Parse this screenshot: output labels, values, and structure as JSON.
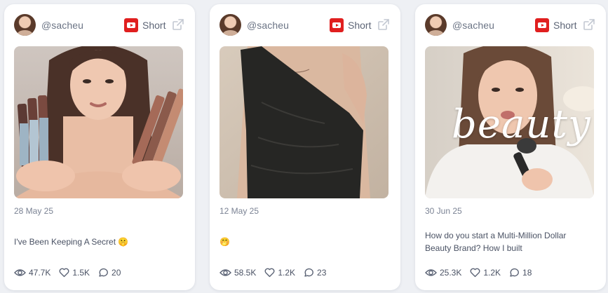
{
  "posts": [
    {
      "handle": "@sacheu",
      "type_label": "Short",
      "date": "28 May 25",
      "caption": "I've Been Keeping A Secret 🤫",
      "stats": {
        "views": "47.7K",
        "likes": "1.5K",
        "comments": "20"
      }
    },
    {
      "handle": "@sacheu",
      "type_label": "Short",
      "date": "12 May 25",
      "caption": "🤭",
      "stats": {
        "views": "58.5K",
        "likes": "1.2K",
        "comments": "23"
      }
    },
    {
      "handle": "@sacheu",
      "type_label": "Short",
      "date": "30 Jun 25",
      "caption": "How do you start a Multi-Million Dollar Beauty Brand? How I built",
      "overlay_text": "beauty",
      "stats": {
        "views": "25.3K",
        "likes": "1.2K",
        "comments": "18"
      }
    }
  ],
  "icons": {
    "platform": "youtube-icon",
    "external_link": "external-link-icon",
    "views": "eye-icon",
    "likes": "heart-icon",
    "comments": "comment-icon"
  },
  "colors": {
    "youtube_red": "#e01f1f",
    "text_muted": "#7b8394",
    "text_body": "#4a5264",
    "card_bg": "#ffffff",
    "page_bg": "#eef0f4"
  }
}
